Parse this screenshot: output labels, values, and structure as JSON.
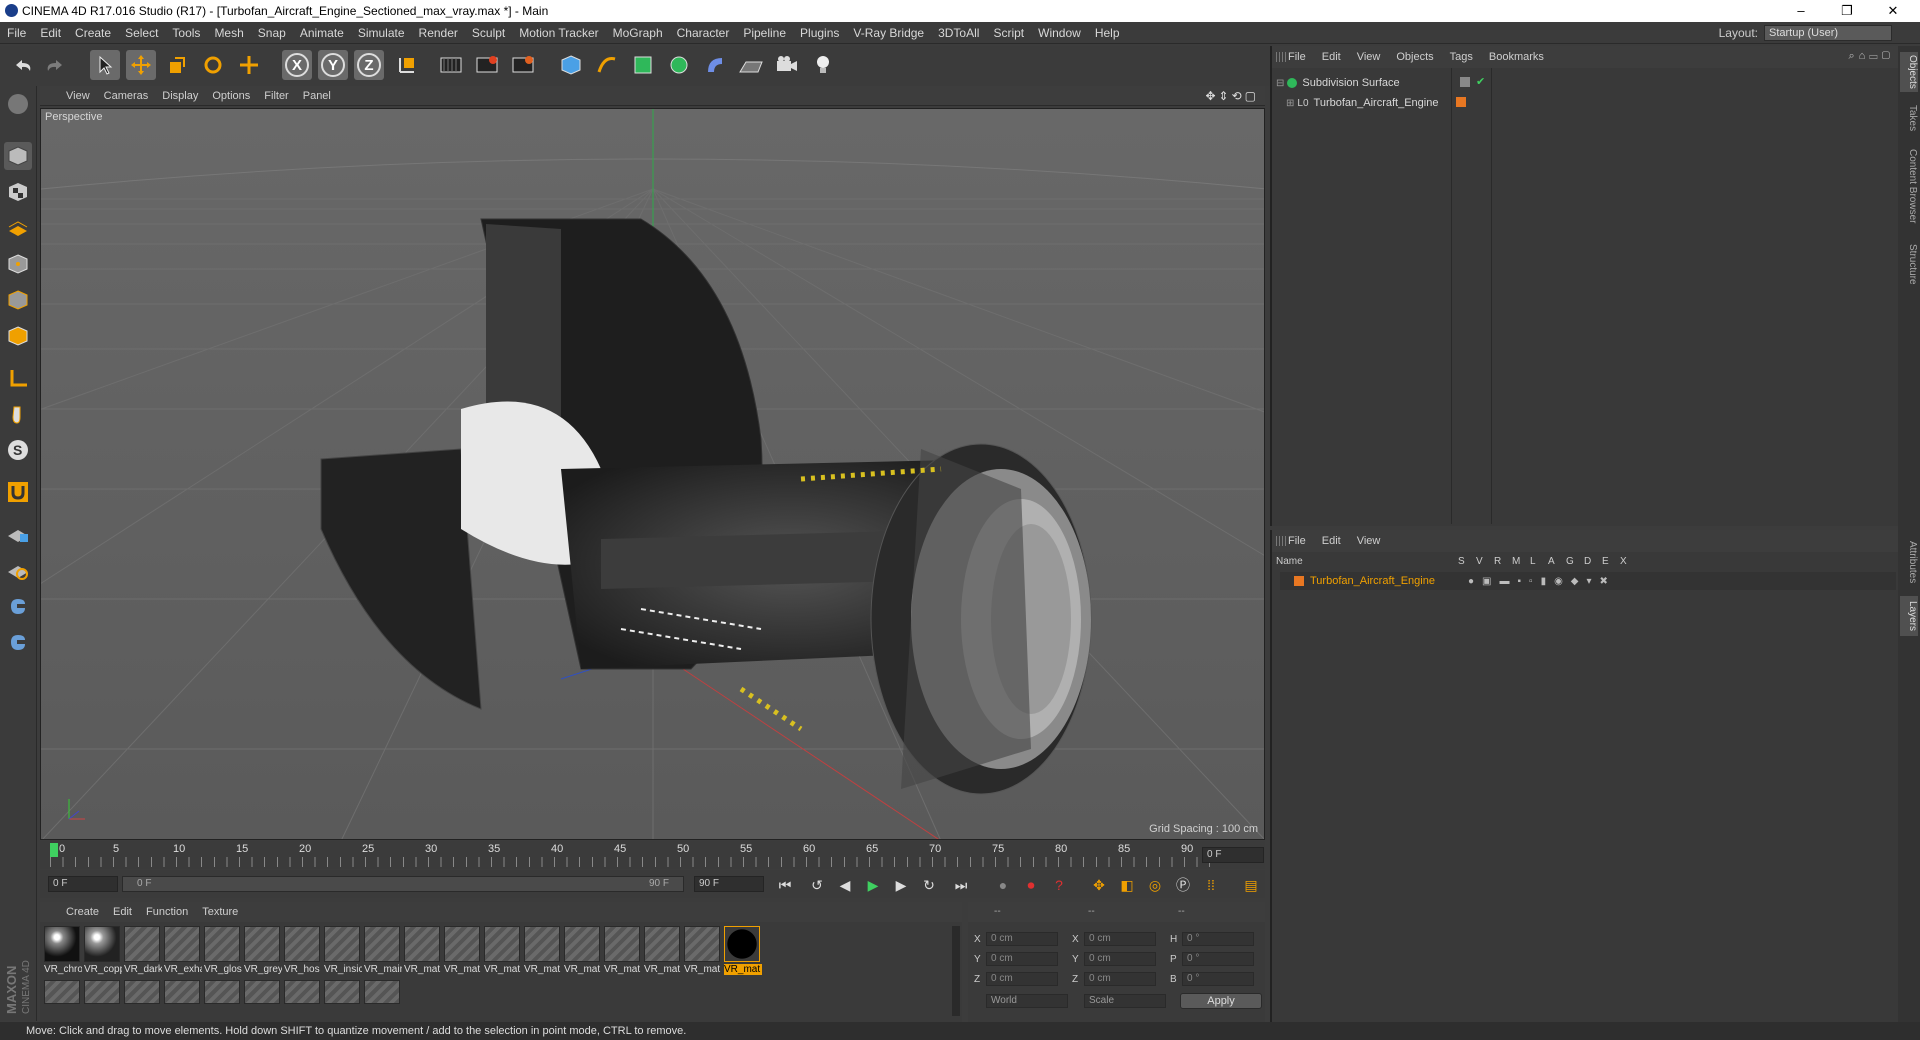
{
  "title": "CINEMA 4D R17.016 Studio (R17) - [Turbofan_Aircraft_Engine_Sectioned_max_vray.max *] - Main",
  "menu": [
    "File",
    "Edit",
    "Create",
    "Select",
    "Tools",
    "Mesh",
    "Snap",
    "Animate",
    "Simulate",
    "Render",
    "Sculpt",
    "Motion Tracker",
    "MoGraph",
    "Character",
    "Pipeline",
    "Plugins",
    "V-Ray Bridge",
    "3DToAll",
    "Script",
    "Window",
    "Help"
  ],
  "layout": {
    "label": "Layout:",
    "value": "Startup (User)"
  },
  "viewport": {
    "menu": [
      "View",
      "Cameras",
      "Display",
      "Options",
      "Filter",
      "Panel"
    ],
    "name": "Perspective",
    "grid_spacing": "Grid Spacing : 100 cm"
  },
  "timeline": {
    "ticks": [
      "0",
      "5",
      "10",
      "15",
      "20",
      "25",
      "30",
      "35",
      "40",
      "45",
      "50",
      "55",
      "60",
      "65",
      "70",
      "75",
      "80",
      "85",
      "90"
    ],
    "current": "0 F"
  },
  "playbar": {
    "start": "0 F",
    "range_start": "0 F",
    "range_end": "90 F",
    "end": "90 F"
  },
  "materials": {
    "menu": [
      "Create",
      "Edit",
      "Function",
      "Texture"
    ],
    "items": [
      "VR_chro",
      "VR_copp",
      "VR_dark",
      "VR_exha",
      "VR_glos",
      "VR_grey",
      "VR_hos",
      "VR_insic",
      "VR_mair",
      "VR_mat",
      "VR_mat",
      "VR_mat",
      "VR_mat",
      "VR_mat",
      "VR_mat",
      "VR_mat",
      "VR_mat",
      "VR_mat"
    ]
  },
  "coords": {
    "header": [
      "--",
      "--",
      "--"
    ],
    "labels": [
      "X",
      "Y",
      "Z",
      "X",
      "Y",
      "Z",
      "H",
      "P",
      "B"
    ],
    "values": [
      "0 cm",
      "0 cm",
      "0 cm",
      "0 cm",
      "0 cm",
      "0 cm",
      "0 °",
      "0 °",
      "0 °"
    ],
    "world": "World",
    "scale": "Scale",
    "apply": "Apply"
  },
  "objects": {
    "menu": [
      "File",
      "Edit",
      "View",
      "Objects",
      "Tags",
      "Bookmarks"
    ],
    "items": [
      "Subdivision Surface",
      "Turbofan_Aircraft_Engine"
    ]
  },
  "layers": {
    "menu": [
      "File",
      "Edit",
      "View"
    ],
    "columns": [
      "Name",
      "S",
      "V",
      "R",
      "M",
      "L",
      "A",
      "G",
      "D",
      "E",
      "X"
    ],
    "items": [
      "Turbofan_Aircraft_Engine"
    ]
  },
  "right_tabs": [
    "Objects",
    "Takes",
    "Content Browser",
    "Structure",
    "Attributes",
    "Layers"
  ],
  "status": "Move: Click and drag to move elements. Hold down SHIFT to quantize movement / add to the selection in point mode, CTRL to remove.",
  "brand": "MAXON CINEMA 4D",
  "colors": {
    "accent": "#f0a000",
    "layer": "#e87722"
  }
}
